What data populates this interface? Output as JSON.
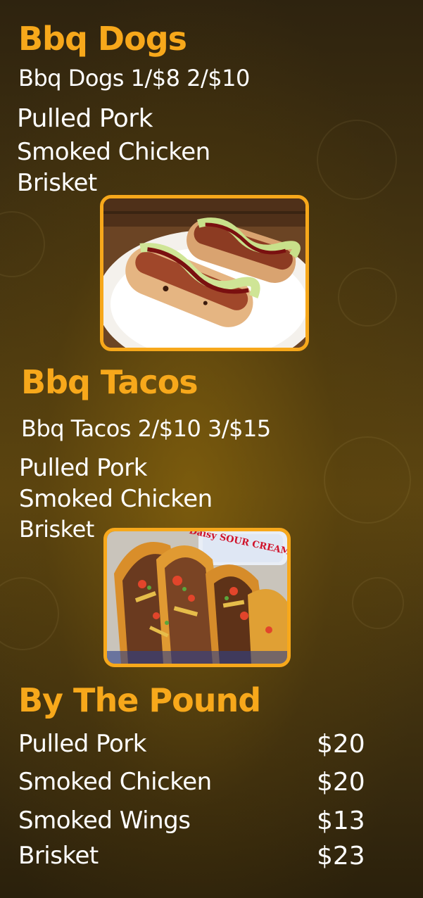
{
  "bbq_dogs": {
    "title": "Bbq Dogs",
    "pricing": "Bbq Dogs 1/$8 2/$10",
    "options": [
      "Pulled Pork",
      "Smoked Chicken",
      "Brisket"
    ]
  },
  "bbq_tacos": {
    "title": "Bbq Tacos",
    "pricing": "Bbq Tacos 2/$10 3/$15",
    "options": [
      "Pulled Pork",
      "Smoked Chicken",
      "Brisket"
    ],
    "photo_label": "Daisy SOUR CREAM"
  },
  "by_the_pound": {
    "title": "By The Pound",
    "items": [
      {
        "name": "Pulled Pork",
        "price": "$20"
      },
      {
        "name": "Smoked Chicken",
        "price": "$20"
      },
      {
        "name": "Smoked Wings",
        "price": "$13"
      },
      {
        "name": "Brisket",
        "price": "$23"
      }
    ]
  },
  "colors": {
    "accent": "#f7a81b",
    "text": "#ffffff",
    "background": "#4a3810"
  }
}
